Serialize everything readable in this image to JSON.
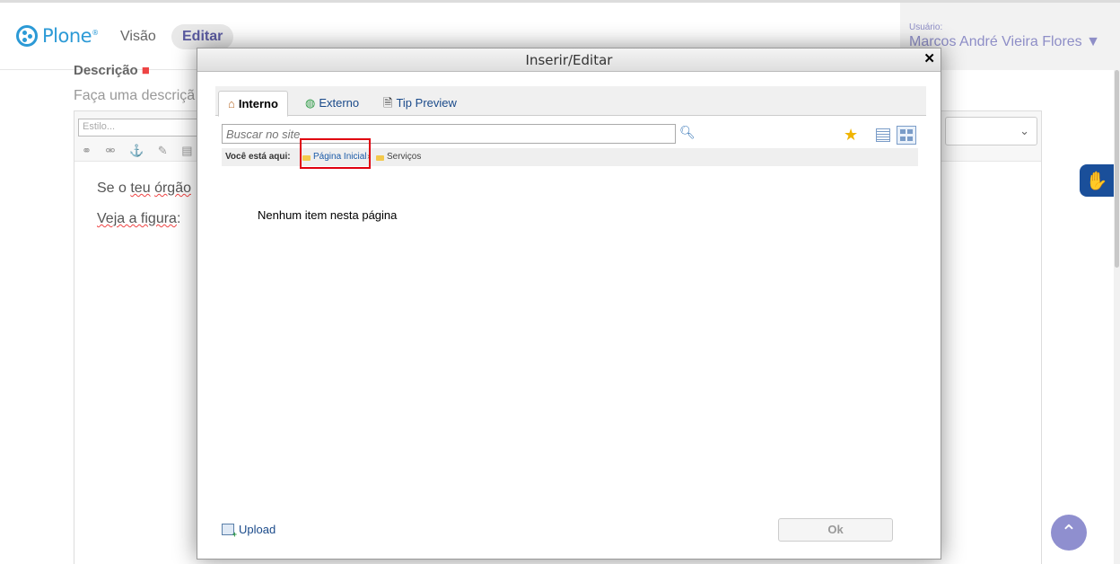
{
  "site": {
    "logo_text": "Plone",
    "nav": {
      "visao": "Visão",
      "editar": "Editar"
    },
    "user": {
      "label": "Usuário:",
      "name": "Marcos André Vieira Flores ▼"
    }
  },
  "form": {
    "field_title": "Descrição",
    "field_hint": "Faça uma descriçã",
    "style_placeholder": "Estilo...",
    "content": {
      "line1_prefix": "Se o ",
      "line1_word1": "teu",
      "line1_word2": "órgão",
      "line2_text": "Veja a figura",
      "line2_suffix": ":"
    }
  },
  "modal": {
    "title": "Inserir/Editar",
    "close_glyph": "✕",
    "tabs": [
      {
        "label": "Interno",
        "active": true
      },
      {
        "label": "Externo",
        "active": false
      },
      {
        "label": "Tip Preview",
        "active": false
      }
    ],
    "search_placeholder": "Buscar no site",
    "breadcrumb": {
      "label": "Você está aqui:",
      "items": [
        "Página Inicial",
        "Serviços"
      ],
      "separator": "›"
    },
    "empty_message": "Nenhum item nesta página",
    "upload_label": "Upload",
    "ok_label": "Ok"
  },
  "accent_colors": {
    "plone_blue": "#2c9ad6",
    "link_blue": "#1a4a8a",
    "highlight_red": "#e0000f"
  }
}
